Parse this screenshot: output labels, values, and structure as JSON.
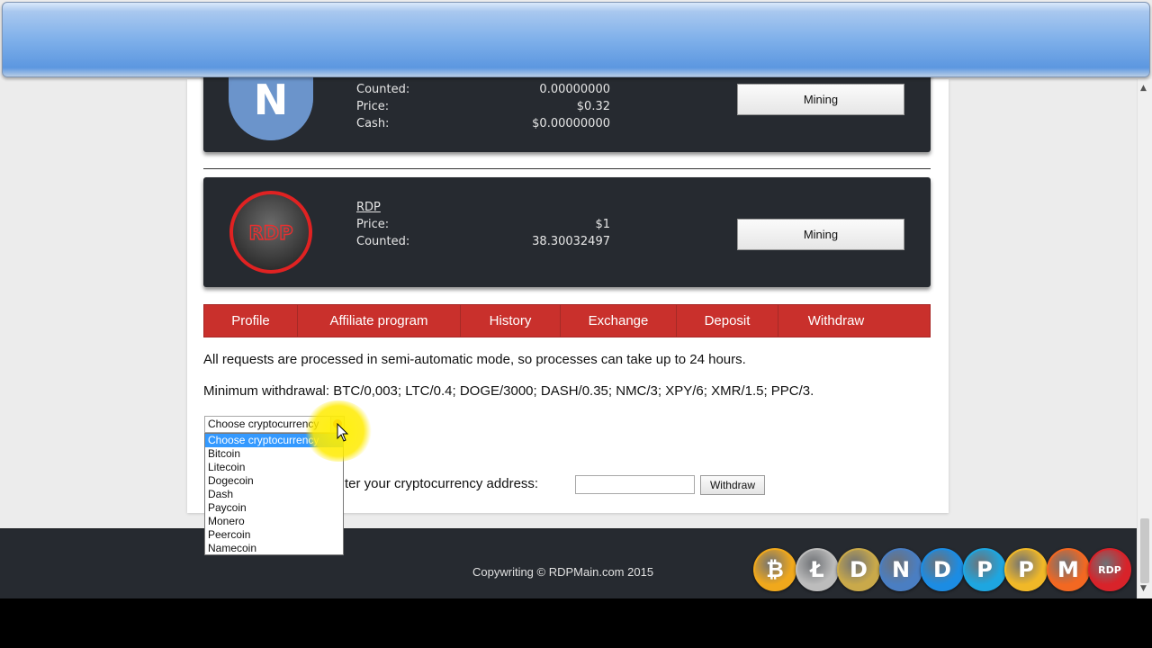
{
  "coins": [
    {
      "name": "",
      "logo": "namecoin-logo-icon",
      "stats": [
        {
          "label": "Counted:",
          "value": "0.00000000"
        },
        {
          "label": "Price:",
          "value": "$0.32"
        },
        {
          "label": "Cash:",
          "value": "$0.00000000"
        }
      ],
      "button": "Mining"
    },
    {
      "name": "RDP",
      "logo_text": "RDP",
      "stats": [
        {
          "label": "Price:",
          "value": "$1"
        },
        {
          "label": "Counted:",
          "value": "38.30032497"
        }
      ],
      "button": "Mining"
    }
  ],
  "nav": [
    "Profile",
    "Affiliate program",
    "History",
    "Exchange",
    "Deposit",
    "Withdraw"
  ],
  "info": {
    "line1": "All requests are processed in semi-automatic mode, so processes can take up to 24 hours.",
    "line2": "Minimum withdrawal: BTC/0,003; LTC/0.4; DOGE/3000; DASH/0.35; NMC/3; XPY/6; XMR/1.5; PPC/3."
  },
  "select": {
    "current": "Choose cryptocurrency",
    "options": [
      "Choose cryptocurrency",
      "Bitcoin",
      "Litecoin",
      "Dogecoin",
      "Dash",
      "Paycoin",
      "Monero",
      "Peercoin",
      "Namecoin"
    ],
    "selected_index": 0
  },
  "address": {
    "label_visible": "ter your cryptocurrency address:",
    "input_value": "",
    "button": "Withdraw"
  },
  "footer": {
    "copyright": "Copywriting © RDPMain.com 2015",
    "coin_icons": [
      {
        "icon": "bitcoin-icon",
        "glyph": "₿",
        "color": "#f0a81c"
      },
      {
        "icon": "litecoin-icon",
        "glyph": "Ł",
        "color": "#bcbcbc"
      },
      {
        "icon": "dogecoin-icon",
        "glyph": "D",
        "color": "#c9a94a"
      },
      {
        "icon": "namecoin-icon",
        "glyph": "N",
        "color": "#4a7ec2"
      },
      {
        "icon": "dash-icon",
        "glyph": "D",
        "color": "#1c8ce3"
      },
      {
        "icon": "paycoin-icon",
        "glyph": "P",
        "color": "#1ea6e0"
      },
      {
        "icon": "peercoin-icon",
        "glyph": "P",
        "color": "#f0b828"
      },
      {
        "icon": "monero-icon",
        "glyph": "M",
        "color": "#f26822"
      },
      {
        "icon": "rdp-icon",
        "glyph": "RDP",
        "color": "#d8232a"
      }
    ]
  },
  "colors": {
    "card_bg": "#262a30",
    "nav_bg": "#c9302c",
    "selected_option": "#3399ff"
  }
}
